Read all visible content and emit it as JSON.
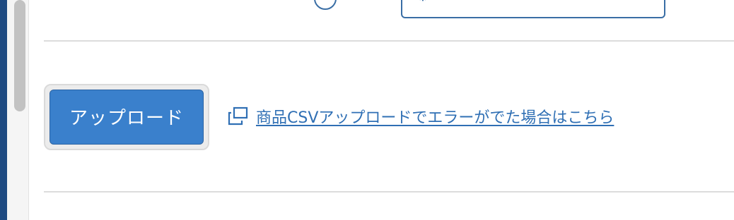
{
  "top": {
    "partial_text": "",
    "select_label": ""
  },
  "upload": {
    "button_label": "アップロード"
  },
  "error_link": {
    "label": "商品CSVアップロードでエラーがでた場合はこちら",
    "icon": "external-window-icon"
  },
  "colors": {
    "primary": "#3a80cc",
    "link": "#2f6fb4",
    "sidebar": "#1f4b82"
  }
}
